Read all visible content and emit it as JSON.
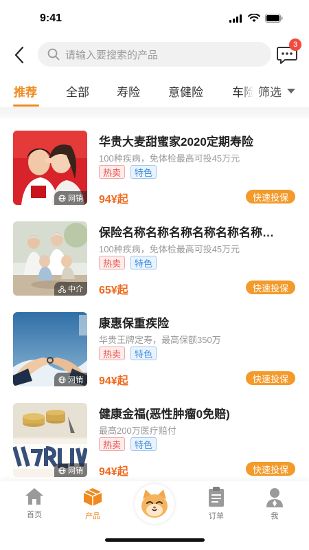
{
  "status": {
    "time": "9:41"
  },
  "search": {
    "placeholder": "请输入要搜索的产品",
    "badge_count": "3"
  },
  "tabs": [
    {
      "label": "推荐",
      "active": true
    },
    {
      "label": "全部",
      "active": false
    },
    {
      "label": "寿险",
      "active": false
    },
    {
      "label": "意健险",
      "active": false
    },
    {
      "label": "车险",
      "active": false
    }
  ],
  "filter_label": "筛选",
  "products": [
    {
      "title": "华贵大麦甜蜜家2020定期寿险",
      "desc": "100种疾病，免体检最高可投45万元",
      "tag_hot": "热卖",
      "tag_feature": "特色",
      "price": "94¥起",
      "channel": "网销",
      "channel_icon": "globe-icon",
      "button": "快速投保"
    },
    {
      "title": "保险名称名称名称名称名称名称…",
      "desc": "100种疾病，免体检最高可投45万元",
      "tag_hot": "热卖",
      "tag_feature": "特色",
      "price": "65¥起",
      "channel": "中介",
      "channel_icon": "share-node-icon",
      "button": "快速投保"
    },
    {
      "title": "康惠保重疾险",
      "desc": "华贵王牌定寿，最高保额350万",
      "tag_hot": "热卖",
      "tag_feature": "特色",
      "price": "94¥起",
      "channel": "网销",
      "channel_icon": "globe-icon",
      "button": "快速投保"
    },
    {
      "title": "健康金福(恶性肿瘤0免赔)",
      "desc": "最高200万医疗赔付",
      "tag_hot": "热卖",
      "tag_feature": "特色",
      "price": "94¥起",
      "channel": "网销",
      "channel_icon": "globe-icon",
      "button": "快速投保"
    }
  ],
  "tabbar": {
    "home": "首页",
    "product": "产品",
    "order": "订单",
    "me": "我"
  },
  "colors": {
    "accent": "#f08a1e",
    "price": "#f06a1e",
    "button": "#f39a2a",
    "badge": "#f04b3f"
  }
}
